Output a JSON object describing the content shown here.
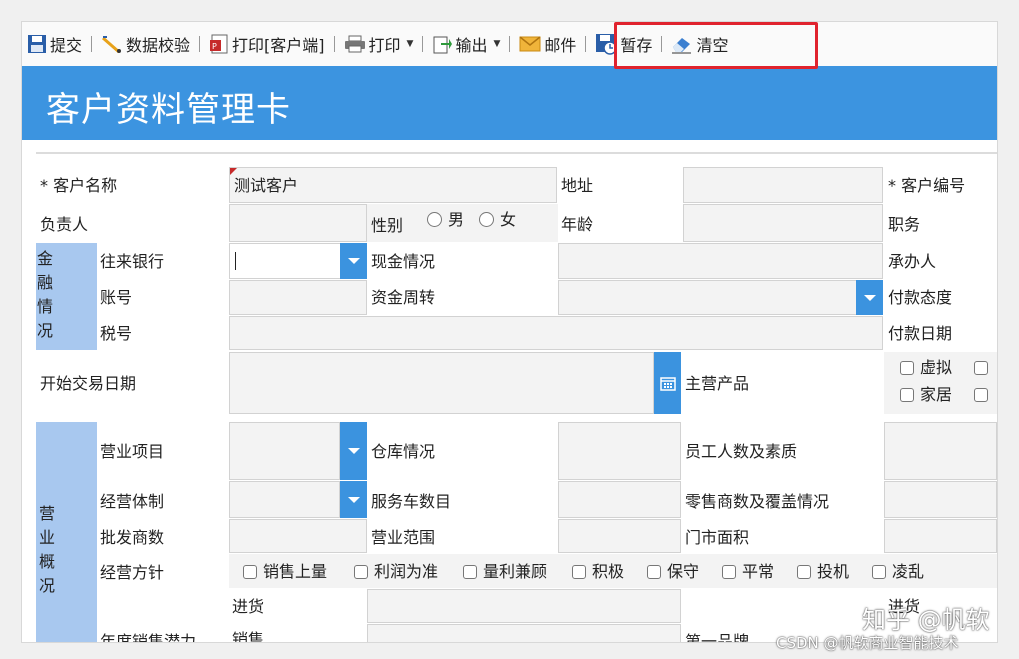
{
  "toolbar": {
    "items": [
      {
        "label": "提交",
        "icon": "save-icon"
      },
      {
        "label": "数据校验",
        "icon": "validate-icon"
      },
      {
        "label": "打印[客户端]",
        "icon": "pdf-print-icon"
      },
      {
        "label": "打印",
        "icon": "printer-icon"
      },
      {
        "label": "输出",
        "icon": "export-icon"
      },
      {
        "label": "邮件",
        "icon": "mail-icon"
      },
      {
        "label": "暂存",
        "icon": "temp-save-icon"
      },
      {
        "label": "清空",
        "icon": "eraser-icon"
      }
    ],
    "highlight_color": "#e0232e"
  },
  "page_title": "客户资料管理卡",
  "colors": {
    "accent": "#3c94e0",
    "section_bg": "#a8c8ef"
  },
  "form": {
    "customer_name_label": "* 客户名称",
    "customer_name_value": "测试客户",
    "address_label": "地址",
    "customer_no_label": "* 客户编号",
    "owner_label": "负责人",
    "gender_label": "性别",
    "gender_male": "男",
    "gender_female": "女",
    "age_label": "年龄",
    "position_label": "职务",
    "finance_section": "金融情况",
    "bank_label": "往来银行",
    "cash_label": "现金情况",
    "handler_label": "承办人",
    "account_label": "账号",
    "capital_label": "资金周转",
    "pay_attitude_label": "付款态度",
    "tax_label": "税号",
    "pay_date_label": "付款日期",
    "start_date_label": "开始交易日期",
    "main_product_label": "主营产品",
    "product_opt1": "虚拟",
    "product_opt2": "家居",
    "business_section": "营业概况",
    "business_item_label": "营业项目",
    "warehouse_label": "仓库情况",
    "staff_label": "员工人数及素质",
    "mgmt_label": "经营体制",
    "vehicles_label": "服务车数目",
    "retail_label": "零售商数及覆盖情况",
    "wholesale_label": "批发商数",
    "scope_label": "营业范围",
    "store_area_label": "门市面积",
    "policy_label": "经营方针",
    "policies": [
      "销售上量",
      "利润为准",
      "量利兼顾",
      "积极",
      "保守",
      "平常",
      "投机",
      "凌乱"
    ],
    "purchase_label": "进货",
    "purchase_label_right": "进货",
    "sales_label": "销售",
    "annual_label": "年度销售潜力",
    "brand_label": "第一品牌"
  },
  "watermarks": {
    "zhihu": "知乎 @帆软",
    "csdn": "CSDN @帆软商业智能技术"
  }
}
